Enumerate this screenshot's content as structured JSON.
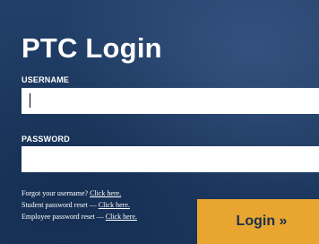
{
  "title": "PTC Login",
  "username": {
    "label": "USERNAME",
    "value": "",
    "placeholder": ""
  },
  "password": {
    "label": "PASSWORD",
    "value": "",
    "placeholder": ""
  },
  "help_links": [
    {
      "prefix": "Forgot your username? ",
      "link": "Click here."
    },
    {
      "prefix": "Student password reset — ",
      "link": "Click here."
    },
    {
      "prefix": "Employee password reset — ",
      "link": "Click here."
    }
  ],
  "login_button": {
    "label": "Login »"
  },
  "colors": {
    "background": "#1f3c64",
    "accent": "#e8a631",
    "text": "#ffffff"
  }
}
